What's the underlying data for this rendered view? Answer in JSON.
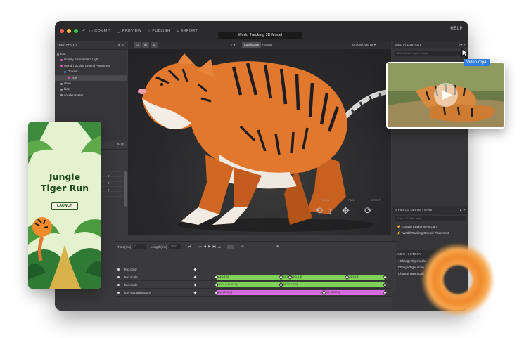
{
  "window": {
    "title": "World Tracking 3D Model",
    "help": "HELP",
    "toolbar": [
      {
        "label": "COMMIT",
        "icon": "commit-icon"
      },
      {
        "label": "PREVIEW",
        "icon": "preview-icon"
      },
      {
        "label": "PUBLISH",
        "icon": "publish-icon"
      },
      {
        "label": "EXPORT",
        "icon": "export-icon"
      }
    ]
  },
  "hierarchy": {
    "header": "HIERARCHY",
    "items": [
      {
        "label": "root",
        "indent": 0,
        "color": "#9a9a9a"
      },
      {
        "label": "Gravity Environment Light",
        "indent": 1,
        "color": "#e05cc4"
      },
      {
        "label": "World Tracking Ground Placement",
        "indent": 1,
        "color": "#e05cc4"
      },
      {
        "label": "Ground",
        "indent": 2,
        "color": "#5c8fe0"
      },
      {
        "label": "Tiger",
        "indent": 3,
        "color": "#e05cc4"
      },
      {
        "label": "show",
        "indent": 1,
        "color": "#9a9a9a"
      },
      {
        "label": "hide",
        "indent": 1,
        "color": "#9a9a9a"
      },
      {
        "label": "accelerometer",
        "indent": 1,
        "color": "#9a9a9a"
      }
    ]
  },
  "properties": {
    "values": [
      "0",
      "0",
      "0"
    ]
  },
  "viewport": {
    "tabs": [
      "Landscape",
      "Portrait"
    ],
    "anchor": "Ground Anchor",
    "controls": [
      "VIEW",
      "PAN",
      "ORBIT"
    ]
  },
  "media_library": {
    "header": "MEDIA LIBRARY",
    "search_placeholder": "Drop files to import media",
    "video_label": "Video.mp4"
  },
  "symbols": {
    "header": "SYMBOL DEFINITIONS",
    "search_placeholder": "Drop LOV files here",
    "items": [
      "Gravity Environment Light",
      "World Tracking Ground Placement"
    ]
  },
  "undo": {
    "header": "UNDO HISTORY",
    "items": [
      "Change Tiger.scale",
      "Change Tiger.scale",
      "Change Tiger.scale"
    ]
  },
  "timeline": {
    "time_label": "Time(ms)",
    "time_value": "0",
    "length_label": "Length(ms)",
    "length_value": "2000",
    "rows": [
      {
        "label": "Text.color",
        "bars": []
      },
      {
        "label": "Text.scale",
        "bars": [
          {
            "text": "[1,1,1,0]",
            "start": 0.02,
            "end": 0.38,
            "color": "#7fd157"
          },
          {
            "text": "[1,1,1,0]",
            "start": 0.38,
            "end": 0.43,
            "color": "#7fd157"
          },
          {
            "text": "[1,1,1,1]",
            "start": 0.43,
            "end": 0.75,
            "color": "#7fd157"
          },
          {
            "text": "[1,1,1,1]",
            "start": 0.75,
            "end": 0.96,
            "color": "#7fd157"
          }
        ]
      },
      {
        "label": "Text.scale",
        "bars": [
          {
            "text": "[0.01,0.01,0.01]",
            "start": 0.02,
            "end": 0.38,
            "color": "#7fd157"
          },
          {
            "text": "[0.7,0.7,0.7]",
            "start": 0.38,
            "end": 0.96,
            "color": "#7fd157"
          }
        ]
      },
      {
        "label": "tiger-run.animations",
        "bars": [
          {
            "text": "full [30100]",
            "start": 0.02,
            "end": 0.62,
            "color": "#d66be0"
          },
          {
            "text": "full [32500]",
            "start": 0.62,
            "end": 0.96,
            "color": "#d66be0"
          }
        ]
      }
    ]
  },
  "game_card": {
    "title_line1": "Jungle",
    "title_line2": "Tiger Run",
    "button": "LAUNCH"
  },
  "colors": {
    "accent": "#2f7de1",
    "keyframe_green": "#7fd157",
    "keyframe_purple": "#d66be0",
    "tiger_orange": "#e2782d"
  }
}
